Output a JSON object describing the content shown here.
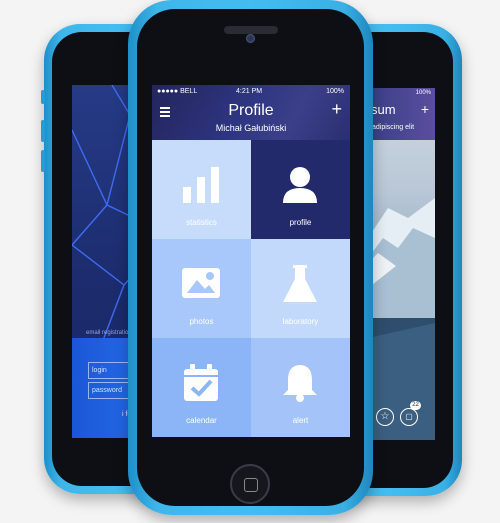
{
  "left_phone": {
    "register_link": "email registration",
    "login_placeholder": "login",
    "password_placeholder": "password",
    "forgot_link": "i forg"
  },
  "center_phone": {
    "status_bar": {
      "carrier": "BELL",
      "time": "4:21 PM",
      "battery": "100%"
    },
    "header": {
      "title": "Profile",
      "subtitle": "Michał Gałubiński",
      "add_label": "+"
    },
    "tiles": [
      {
        "label": "statistics",
        "icon": "bar-chart-icon",
        "color": "#c7dcfb"
      },
      {
        "label": "profile",
        "icon": "user-icon",
        "color": "#232a6b"
      },
      {
        "label": "photos",
        "icon": "image-icon",
        "color": "#a8c7fa"
      },
      {
        "label": "laboratory",
        "icon": "flask-icon",
        "color": "#c2d9fb"
      },
      {
        "label": "calendar",
        "icon": "calendar-icon",
        "color": "#8cb5f8"
      },
      {
        "label": "alert",
        "icon": "bell-icon",
        "color": "#a3c3f9"
      }
    ]
  },
  "right_phone": {
    "status_battery": "100%",
    "title_fragment": "sum",
    "subtitle_fragment": "adipiscing elit",
    "badge_count": "22"
  }
}
